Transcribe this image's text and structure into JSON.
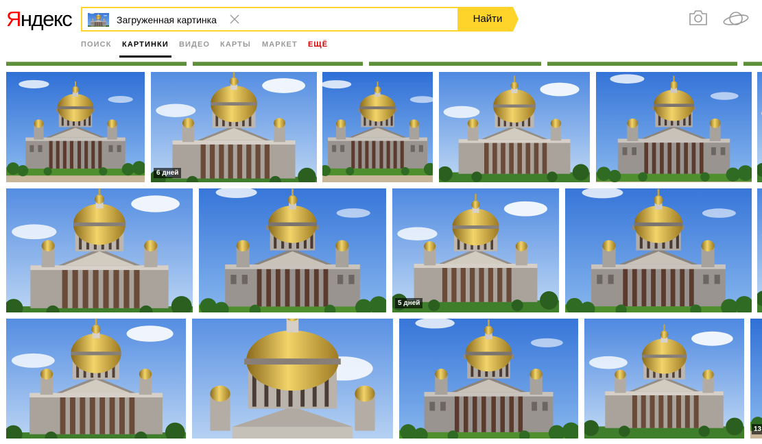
{
  "logo": {
    "first": "Я",
    "rest": "ндекс"
  },
  "search": {
    "value": "Загруженная картинка",
    "button": "Найти"
  },
  "tabs": [
    {
      "label": "ПОИСК",
      "state": "inactive"
    },
    {
      "label": "КАРТИНКИ",
      "state": "active"
    },
    {
      "label": "ВИДЕО",
      "state": "inactive"
    },
    {
      "label": "КАРТЫ",
      "state": "inactive"
    },
    {
      "label": "МАРКЕТ",
      "state": "inactive"
    },
    {
      "label": "ЕЩЁ",
      "state": "more"
    }
  ],
  "icons": {
    "camera": "camera-icon",
    "account": "saturn-icon",
    "clear": "close-icon"
  },
  "results": {
    "badges": [
      "6 дней",
      "5 дней",
      "13"
    ]
  },
  "colors": {
    "accent": "#fed42b",
    "logo_red": "#ff0000",
    "more_tab": "#cc0000",
    "sky": "#3a78d8",
    "gold": "#d8b33c"
  }
}
